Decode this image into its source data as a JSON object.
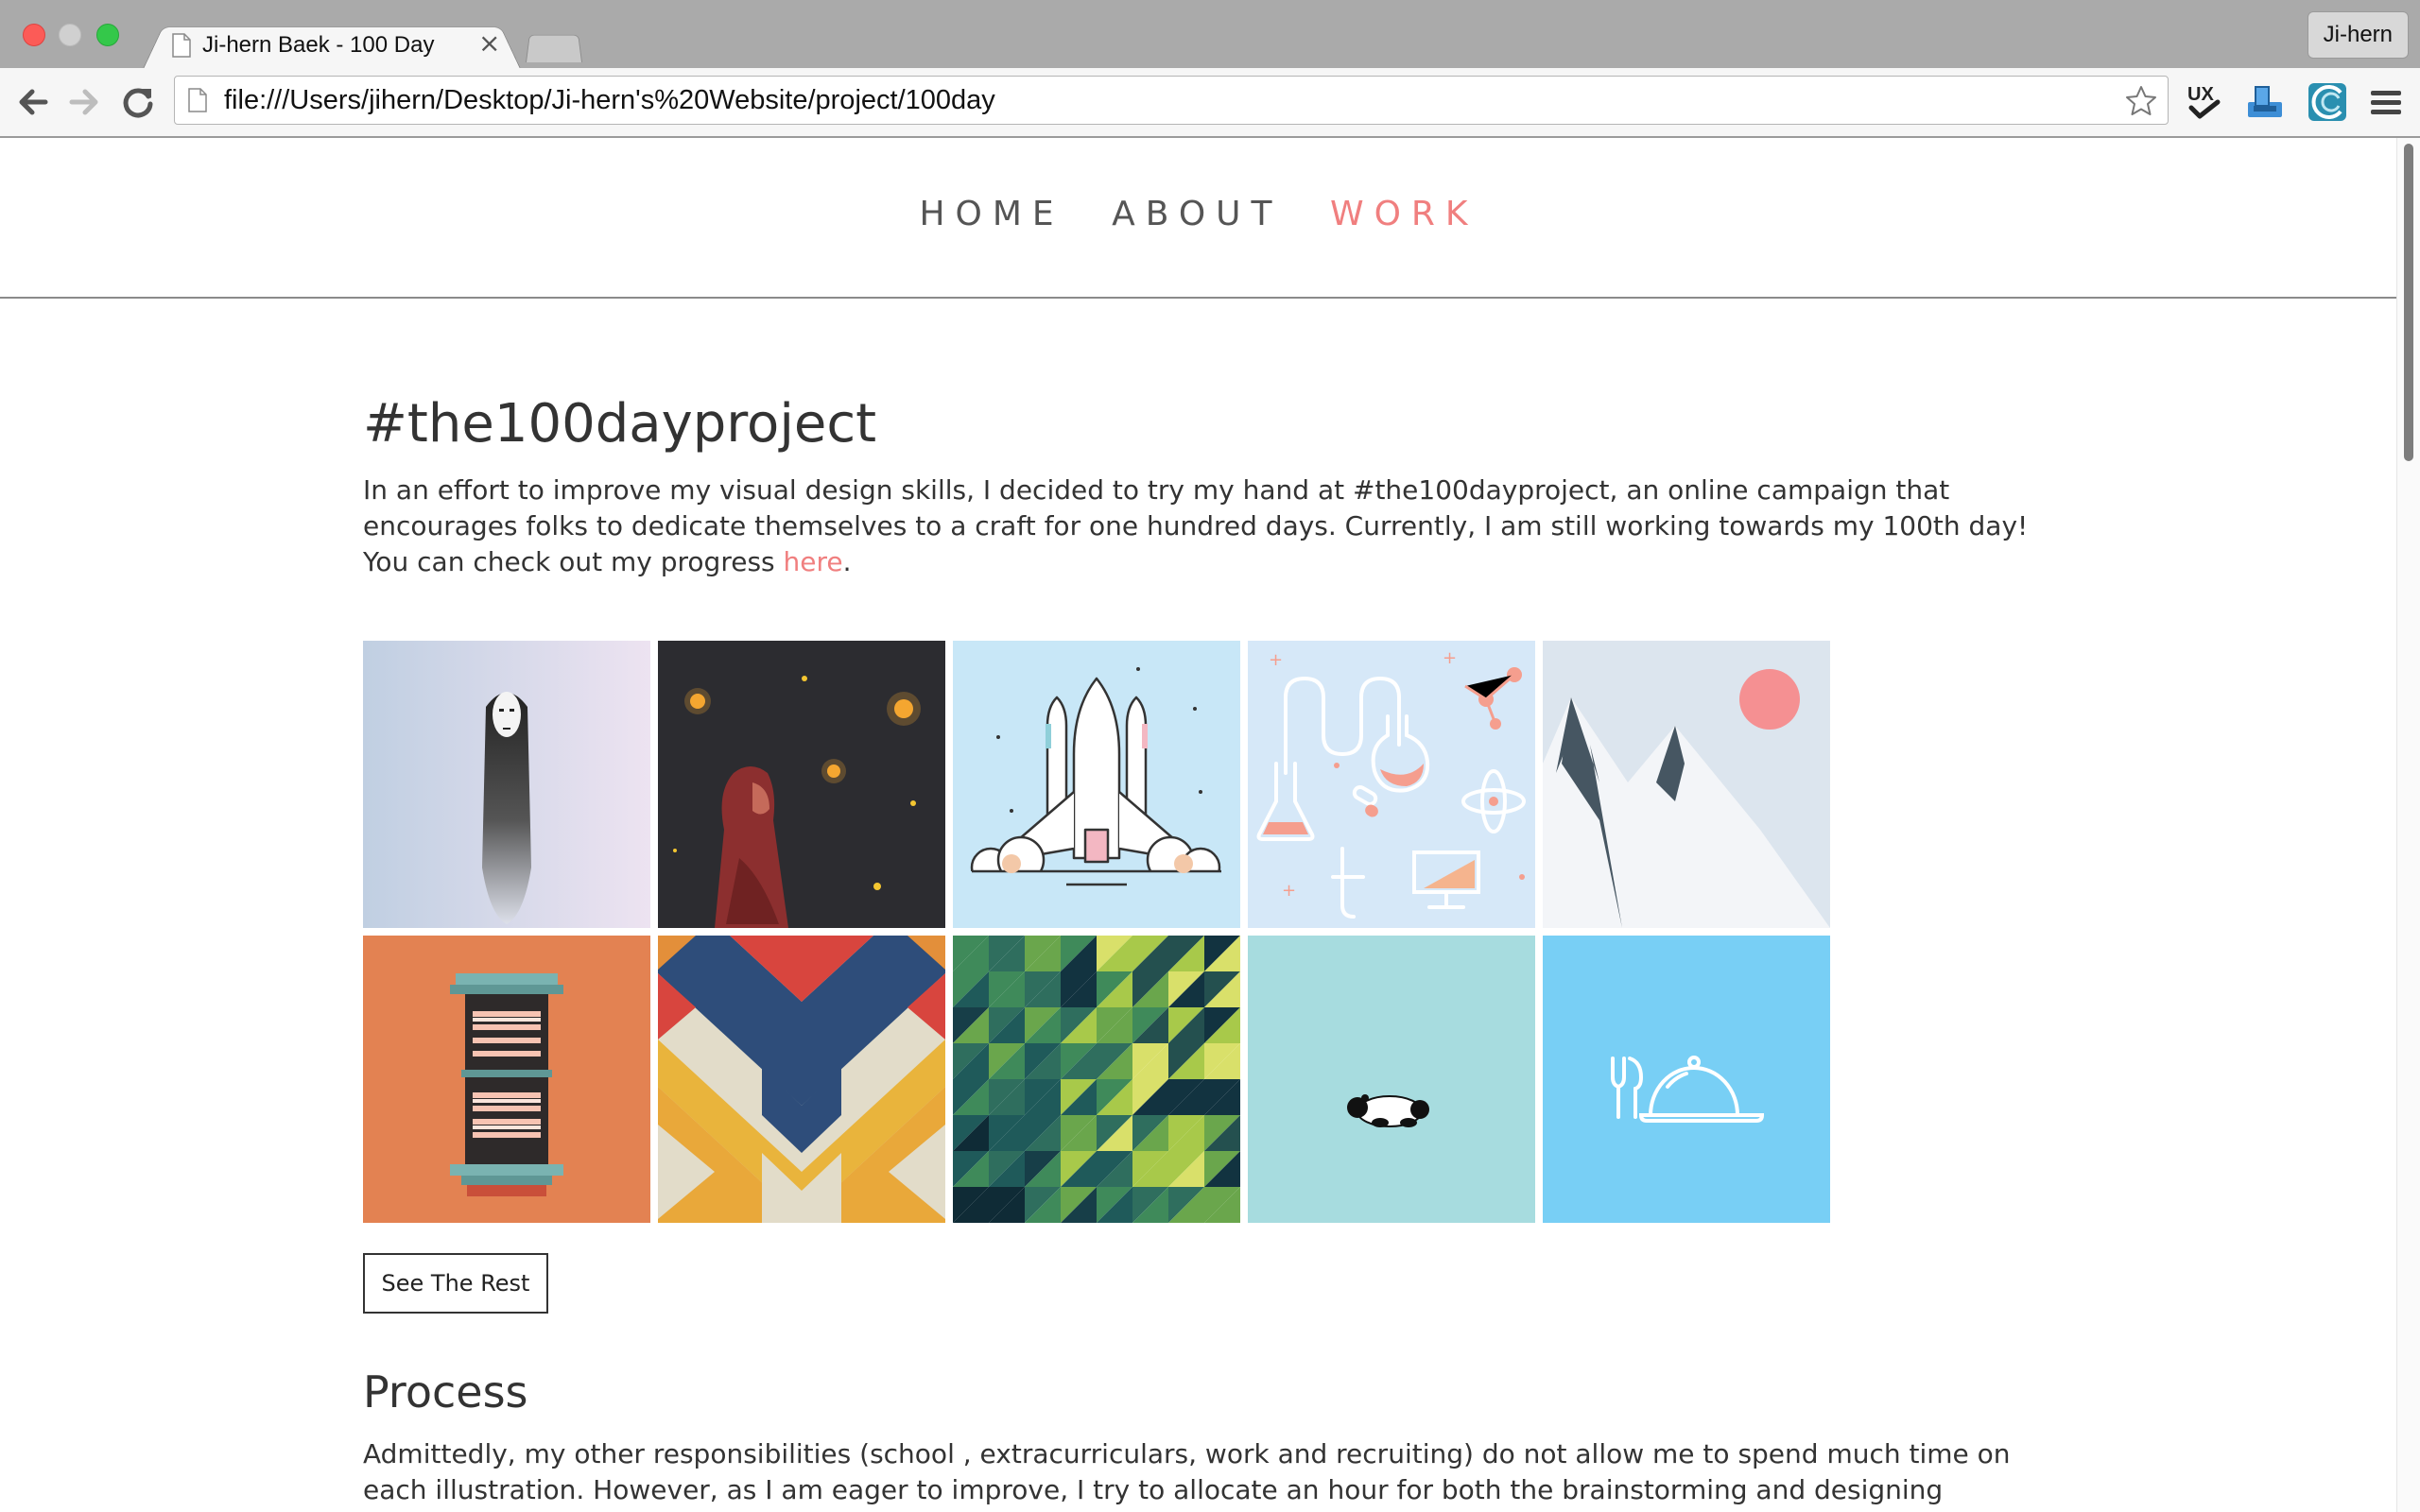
{
  "browser": {
    "tab_title": "Ji-hern Baek - 100 Day",
    "tab_close_glyph": "×",
    "profile_name": "Ji-hern",
    "url": "file:///Users/jihern/Desktop/Ji-hern's%20Website/project/100day",
    "icons": [
      "back-arrow-icon",
      "forward-arrow-icon",
      "reload-icon",
      "page-icon",
      "bookmark-star-icon",
      "ux-check-extension-icon",
      "inbox-extension-icon",
      "wave-extension-icon",
      "menu-icon"
    ]
  },
  "nav": {
    "items": [
      "HOME",
      "ABOUT",
      "WORK"
    ],
    "active": "WORK",
    "active_color": "#f07f7f"
  },
  "project": {
    "title": "#the100dayproject",
    "intro_text": "In an effort to improve my visual design skills, I decided to try my hand at #the100dayproject, an online campaign that encourages folks to dedicate themselves to a craft for one hundred days. Currently, I am still working towards my 100th day! You can check out my progress ",
    "intro_link": "here",
    "intro_end": ".",
    "gallery": [
      "no-face-illustration",
      "red-hood-fireflies-illustration",
      "space-shuttle-launch-illustration",
      "science-lab-icons-illustration",
      "mountains-red-sun-illustration",
      "window-shelf-illustration",
      "chevron-pattern-illustration",
      "green-triangle-mosaic-illustration",
      "sleeping-panda-illustration",
      "dinner-cloche-illustration"
    ],
    "see_rest_label": "See The Rest"
  },
  "process": {
    "heading": "Process",
    "text": "Admittedly, my other responsibilities (school , extracurriculars, work and recruiting) do not allow me to spend much time on each illustration. However, as I am eager to improve, I try to allocate an hour for both the brainstorming and designing processes. I'll typically"
  }
}
